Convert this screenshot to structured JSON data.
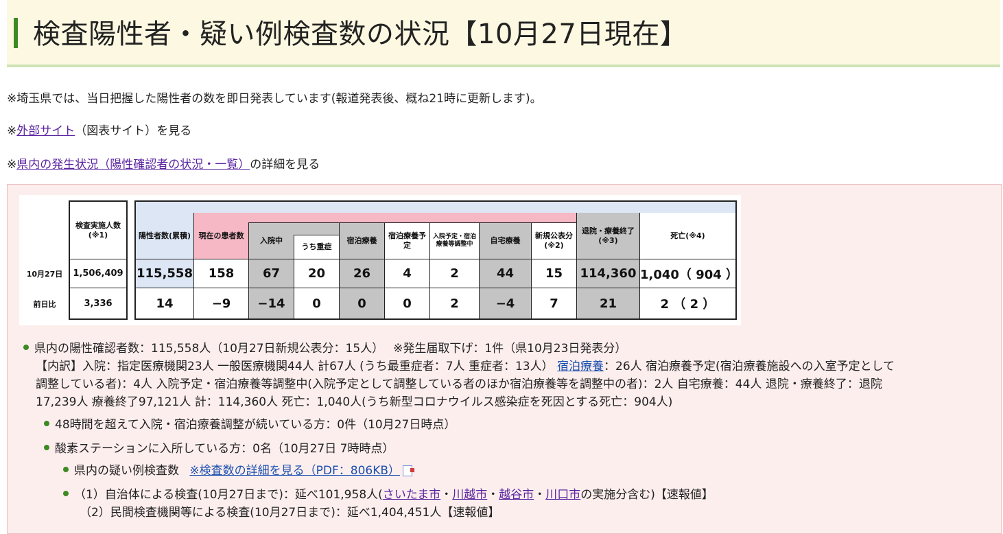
{
  "header": {
    "title": "検査陽性者・疑い例検査数の状況【10月27日現在】"
  },
  "notes": {
    "line1": "※埼玉県では、当日把握した陽性者の数を即日発表しています(報道発表後、概ね21時に更新します)。",
    "line2_prefix": "※",
    "line2_link": "外部サイト",
    "line2_suffix": "（図表サイト）を見る",
    "line3_prefix": "※",
    "line3_link": "県内の発生状況（陽性確認者の状況・一覧）",
    "line3_suffix": "の詳細を見る"
  },
  "table": {
    "headers": {
      "tested": "検査実施人数(※1)",
      "positive": "陽性者数(累積)",
      "current": "現在の患者数",
      "hospital": "入院中",
      "severe": "うち重症",
      "lodging": "宿泊療養",
      "lodging_plan": "宿泊療養予定",
      "adjusting": "入院予定・宿泊療養等調整中",
      "home": "自宅療養",
      "new": "新規公表分(※2)",
      "recovered": "退院・療養終了(※3)",
      "deaths": "死亡(※4)"
    },
    "rows": [
      {
        "label": "10月27日",
        "tested": "1,506,409",
        "positive": "115,558",
        "current": "158",
        "hospital": "67",
        "severe": "20",
        "lodging": "26",
        "lodging_plan": "4",
        "adjusting": "2",
        "home": "44",
        "new": "15",
        "recovered": "114,360",
        "deaths": "1,040（ 904 ）"
      },
      {
        "label": "前日比",
        "tested": "3,336",
        "positive": "14",
        "current": "−9",
        "hospital": "−14",
        "severe": "0",
        "lodging": "0",
        "lodging_plan": "0",
        "adjusting": "2",
        "home": "−4",
        "new": "7",
        "recovered": "21",
        "deaths": "2 （ 2 ）"
      }
    ]
  },
  "details": {
    "summary": "県内の陽性確認者数：115,558人（10月27日新規公表分：15人）　 ※発生届取下げ：1件（県10月23日発表分）",
    "breakdown1_prefix": "【内訳】入院：指定医療機関23人 一般医療機関44人 計67人 (うち最重症者：7人 重症者：13人） ",
    "breakdown1_link": "宿泊療養",
    "breakdown1_suffix": "：26人 宿泊療養予定(宿泊療養施設への入室予定として",
    "breakdown2": "調整している者)：4人 入院予定・宿泊療養等調整中(入院予定として調整している者のほか宿泊療養等を調整中の者)：2人 自宅療養：44人 退院・療養終了：退院",
    "breakdown3": "17,239人 療養終了97,121人 計：114,360人 死亡：1,040人(うち新型コロナウイルス感染症を死因とする死亡：904人)",
    "over48": "48時間を超えて入院・宿泊療養調整が続いている方：0件（10月27日時点）",
    "oxygen": "酸素ステーションに入所している方：0名（10月27日 7時時点）",
    "suspect_label": "県内の疑い例検査数",
    "suspect_link": "※検査数の詳細を見る（PDF：806KB）",
    "local_prefix": "（1）自治体による検査(10月27日まで)：延べ101,958人(",
    "local_city1": "さいたま市",
    "local_sep1": "・",
    "local_city2": "川越市",
    "local_sep2": "・",
    "local_city3": "越谷市",
    "local_sep3": "・",
    "local_city4": "川口市",
    "local_suffix": "の実施分含む)【速報値】",
    "private": "（2）民間検査機関等による検査(10月27日まで)：延べ1,404,451人【速報値】"
  },
  "colors": {
    "accent_green": "#3d8a22",
    "title_bg": "#fcf8e1",
    "box_bg": "#fdeeee",
    "header_blue": "#dde6f5",
    "header_pink": "#f5b8c4",
    "header_gray": "#c4c4c4",
    "link_purple": "#5a24a0",
    "link_blue": "#1a4fae"
  },
  "icons": {
    "pdf": "pdf-icon"
  }
}
